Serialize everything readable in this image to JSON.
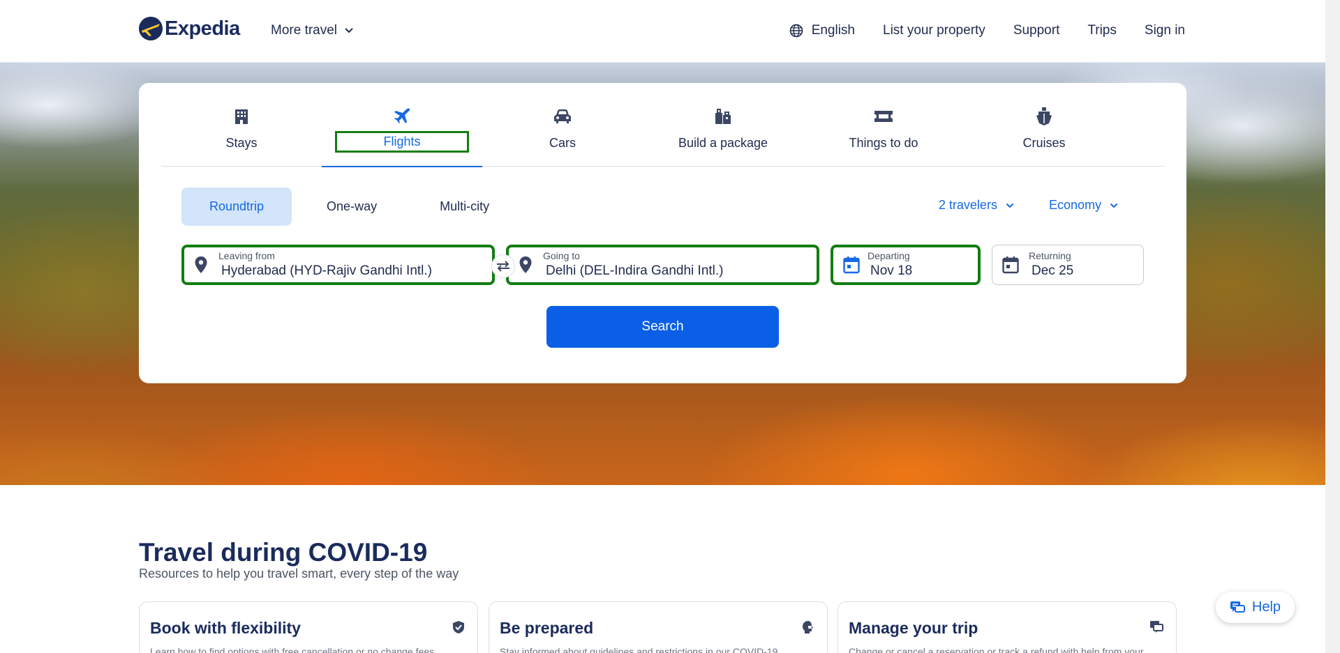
{
  "header": {
    "brand": "Expedia",
    "more_travel": "More travel",
    "nav": {
      "language": "English",
      "list_property": "List your property",
      "support": "Support",
      "trips": "Trips",
      "sign_in": "Sign in"
    }
  },
  "search_card": {
    "tabs": [
      {
        "label": "Stays",
        "icon": "building-icon"
      },
      {
        "label": "Flights",
        "icon": "plane-icon",
        "active": true
      },
      {
        "label": "Cars",
        "icon": "car-icon"
      },
      {
        "label": "Build a package",
        "icon": "luggage-icon"
      },
      {
        "label": "Things to do",
        "icon": "ticket-icon"
      },
      {
        "label": "Cruises",
        "icon": "ship-icon"
      }
    ],
    "trip_types": {
      "roundtrip": "Roundtrip",
      "one_way": "One-way",
      "multi_city": "Multi-city",
      "selected": "Roundtrip"
    },
    "travelers": "2 travelers",
    "cabin_class": "Economy",
    "leaving_from": {
      "label": "Leaving from",
      "value": "Hyderabad (HYD-Rajiv Gandhi Intl.)"
    },
    "going_to": {
      "label": "Going to",
      "value": "Delhi (DEL-Indira Gandhi Intl.)"
    },
    "departing": {
      "label": "Departing",
      "value": "Nov 18"
    },
    "returning": {
      "label": "Returning",
      "value": "Dec 25"
    },
    "search_label": "Search"
  },
  "covid": {
    "title": "Travel during COVID-19",
    "subtitle": "Resources to help you travel smart, every step of the way",
    "cards": [
      {
        "title": "Book with flexibility",
        "text": "Learn how to find options with free cancellation or no change fees",
        "icon": "shield-check-icon"
      },
      {
        "title": "Be prepared",
        "text": "Stay informed about guidelines and restrictions in our COVID-19",
        "icon": "head-mask-icon"
      },
      {
        "title": "Manage your trip",
        "text": "Change or cancel a reservation or track a refund with help from your",
        "icon": "chat-icon"
      }
    ]
  },
  "help_label": "Help",
  "colors": {
    "brand_navy": "#1a2b5c",
    "accent_blue": "#1668e3",
    "search_button": "#0a5fe6",
    "highlight_green": "#127d12",
    "selected_pill": "#d3e5fb"
  }
}
